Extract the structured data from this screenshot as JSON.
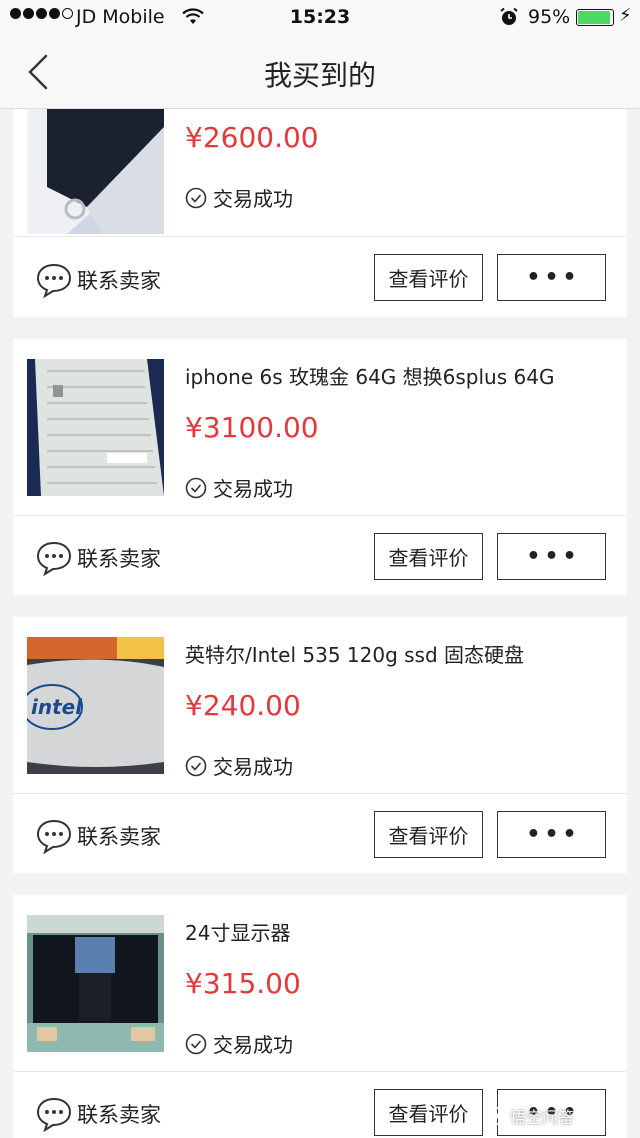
{
  "status_bar": {
    "carrier": "JD Mobile",
    "time": "15:23",
    "battery_pct": "95%",
    "battery_level": 0.95
  },
  "nav": {
    "title": "我买到的"
  },
  "colors": {
    "price": "#e4393c",
    "battery": "#4cd964"
  },
  "orders": [
    {
      "name": "",
      "price": "¥2600.00",
      "status": "交易成功",
      "contact": "联系卖家",
      "review": "查看评价",
      "more": "•••"
    },
    {
      "name": "iphone 6s 玫瑰金 64G 想换6splus 64G",
      "price": "¥3100.00",
      "status": "交易成功",
      "contact": "联系卖家",
      "review": "查看评价",
      "more": "•••"
    },
    {
      "name": "英特尔/Intel 535 120g ssd 固态硬盘",
      "price": "¥240.00",
      "status": "交易成功",
      "contact": "联系卖家",
      "review": "查看评价",
      "more": "•••"
    },
    {
      "name": "24寸显示器",
      "price": "¥315.00",
      "status": "交易成功",
      "contact": "联系卖家",
      "review": "查看评价",
      "more": "•••"
    }
  ],
  "thumbnail_texts": {
    "intel_logo": "intel"
  },
  "watermark": {
    "text": "悟空问答"
  }
}
